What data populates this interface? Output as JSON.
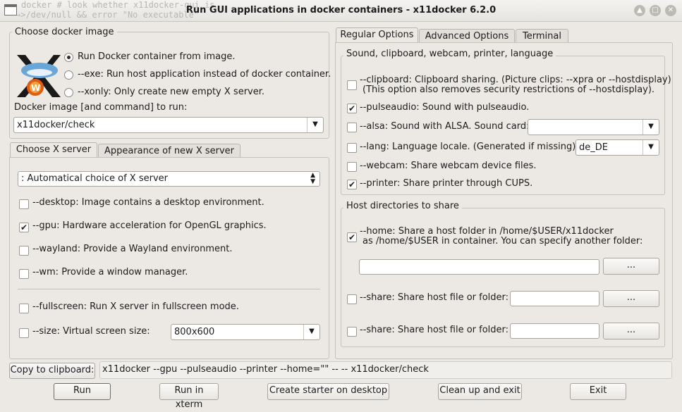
{
  "window": {
    "title": "Run GUI applications in docker containers - x11docker 6.2.0",
    "terminal_bg_lines": [
      "  docker  # look whether x11docker-gui is",
      "→>/dev/null && error \"No executable\""
    ]
  },
  "choose_image": {
    "legend": "Choose docker image",
    "radio_run": "Run Docker container from image.",
    "radio_exe": "--exe: Run host application instead of docker container.",
    "radio_xonly": "--xonly: Only create new empty X server.",
    "image_label": "Docker image [and command] to run:",
    "image_value": "x11docker/check"
  },
  "left_tabs": {
    "tab1": "Choose X server",
    "tab2": "Appearance of new X server"
  },
  "xserver": {
    "select_value": ": Automatical choice of X server",
    "desktop": "--desktop: Image contains a desktop environment.",
    "gpu": "--gpu: Hardware acceleration for OpenGL graphics.",
    "wayland": "--wayland: Provide a Wayland environment.",
    "wm": "--wm: Provide a window manager.",
    "fullscreen": "--fullscreen: Run X server in fullscreen mode.",
    "size": "--size: Virtual screen size:",
    "size_value": "800x600",
    "gpu_checked": "✔"
  },
  "right_tabs": {
    "tab1": "Regular Options",
    "tab2": "Advanced Options",
    "tab3": "Terminal"
  },
  "sound": {
    "legend": "Sound, clipboard, webcam, printer, language",
    "clipboard_line1": "--clipboard: Clipboard sharing. (Picture clips: --xpra or --hostdisplay)",
    "clipboard_line2": "(This option also removes security restrictions of --hostdisplay).",
    "pulseaudio": "--pulseaudio: Sound with pulseaudio.",
    "alsa": "--alsa: Sound with ALSA. Sound card:",
    "lang": "--lang: Language locale. (Generated if missing):",
    "lang_value": "de_DE",
    "webcam": "--webcam: Share webcam device files.",
    "printer": "--printer: Share printer through CUPS.",
    "check_mark": "✔"
  },
  "hostdirs": {
    "legend": "Host directories to share",
    "home_line1": "--home: Share a host folder in /home/$USER/x11docker",
    "home_line2": "as /home/$USER in container. You can specify another folder:",
    "share1": "--share: Share host file or folder:",
    "share2": "--share: Share host file or folder:",
    "browse": "..."
  },
  "bottom": {
    "copy_button": "Copy to clipboard:",
    "command": "x11docker --gpu --pulseaudio --printer --home=\"\" --  --  x11docker/check",
    "run": "Run",
    "run_xterm": "Run in xterm",
    "starter": "Create starter on desktop",
    "cleanup": "Clean up and exit",
    "exit": "Exit"
  },
  "icons": {
    "window_buttons": [
      "up-arrow",
      "restore",
      "close"
    ]
  }
}
